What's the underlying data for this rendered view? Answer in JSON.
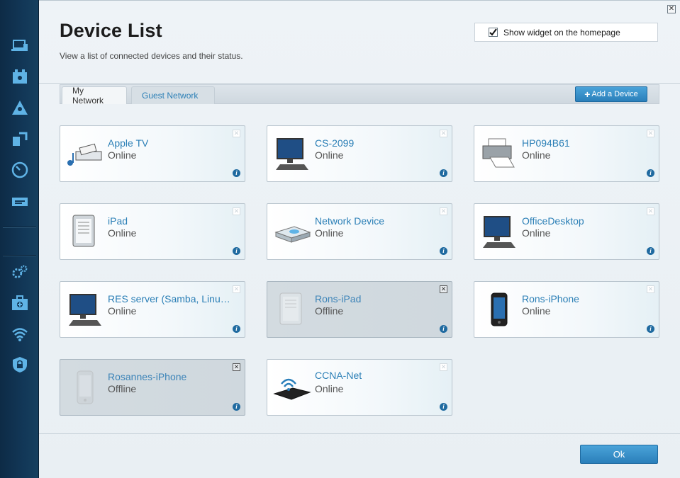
{
  "page": {
    "title": "Device List",
    "subtitle": "View a list of connected devices and their status.",
    "widget_label": "Show widget on the homepage",
    "widget_checked": true
  },
  "tabs": [
    {
      "label": "My Network",
      "active": true
    },
    {
      "label": "Guest Network",
      "active": false
    }
  ],
  "add_device_label": "Add a Device",
  "ok_label": "Ok",
  "sidebar_icons": [
    "devices-icon",
    "parental-controls-icon",
    "network-map-icon",
    "media-prioritization-icon",
    "speed-test-icon",
    "usb-storage-icon",
    "settings-icon",
    "troubleshooting-icon",
    "wireless-icon",
    "security-icon"
  ],
  "devices": [
    {
      "name": "Apple TV",
      "status": "Online",
      "icon": "media-device-icon",
      "offline": false
    },
    {
      "name": "CS-2099",
      "status": "Online",
      "icon": "desktop-computer-icon",
      "offline": false
    },
    {
      "name": "HP094B61",
      "status": "Online",
      "icon": "printer-icon",
      "offline": false
    },
    {
      "name": "iPad",
      "status": "Online",
      "icon": "tablet-icon",
      "offline": false
    },
    {
      "name": "Network Device",
      "status": "Online",
      "icon": "network-device-icon",
      "offline": false
    },
    {
      "name": "OfficeDesktop",
      "status": "Online",
      "icon": "desktop-computer-icon",
      "offline": false
    },
    {
      "name": "RES server (Samba, Linu…",
      "status": "Online",
      "icon": "desktop-computer-icon",
      "offline": false
    },
    {
      "name": "Rons-iPad",
      "status": "Offline",
      "icon": "tablet-icon",
      "offline": true
    },
    {
      "name": "Rons-iPhone",
      "status": "Online",
      "icon": "phone-icon",
      "offline": false
    },
    {
      "name": "Rosannes-iPhone",
      "status": "Offline",
      "icon": "phone-icon",
      "offline": true
    },
    {
      "name": "CCNA-Net",
      "status": "Online",
      "icon": "wireless-router-icon",
      "offline": false
    }
  ],
  "colors": {
    "accent": "#2b7fb6",
    "sidebar": "#123757",
    "button": "#2a7fba"
  }
}
